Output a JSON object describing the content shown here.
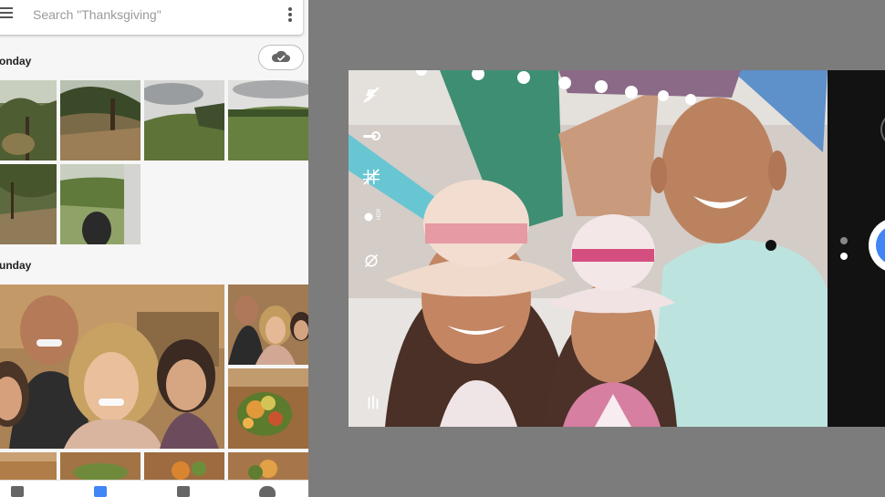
{
  "search": {
    "placeholder": "Search \"Thanksgiving\""
  },
  "sections": [
    {
      "label": "onday"
    },
    {
      "label": "unday"
    }
  ],
  "icons": {
    "menu": "menu-icon",
    "more": "more-vert-icon",
    "cloud": "cloud-done-icon",
    "flash": "flash-off-icon",
    "timer": "timer-icon",
    "grid": "grid-off-icon",
    "hdr": "hdr-plus-icon",
    "white_balance": "white-balance-off-icon",
    "shutter": "shutter-button"
  },
  "colors": {
    "accent": "#4285f4",
    "panel_bg": "#f6f6f6",
    "camera_bar": "#121212"
  }
}
